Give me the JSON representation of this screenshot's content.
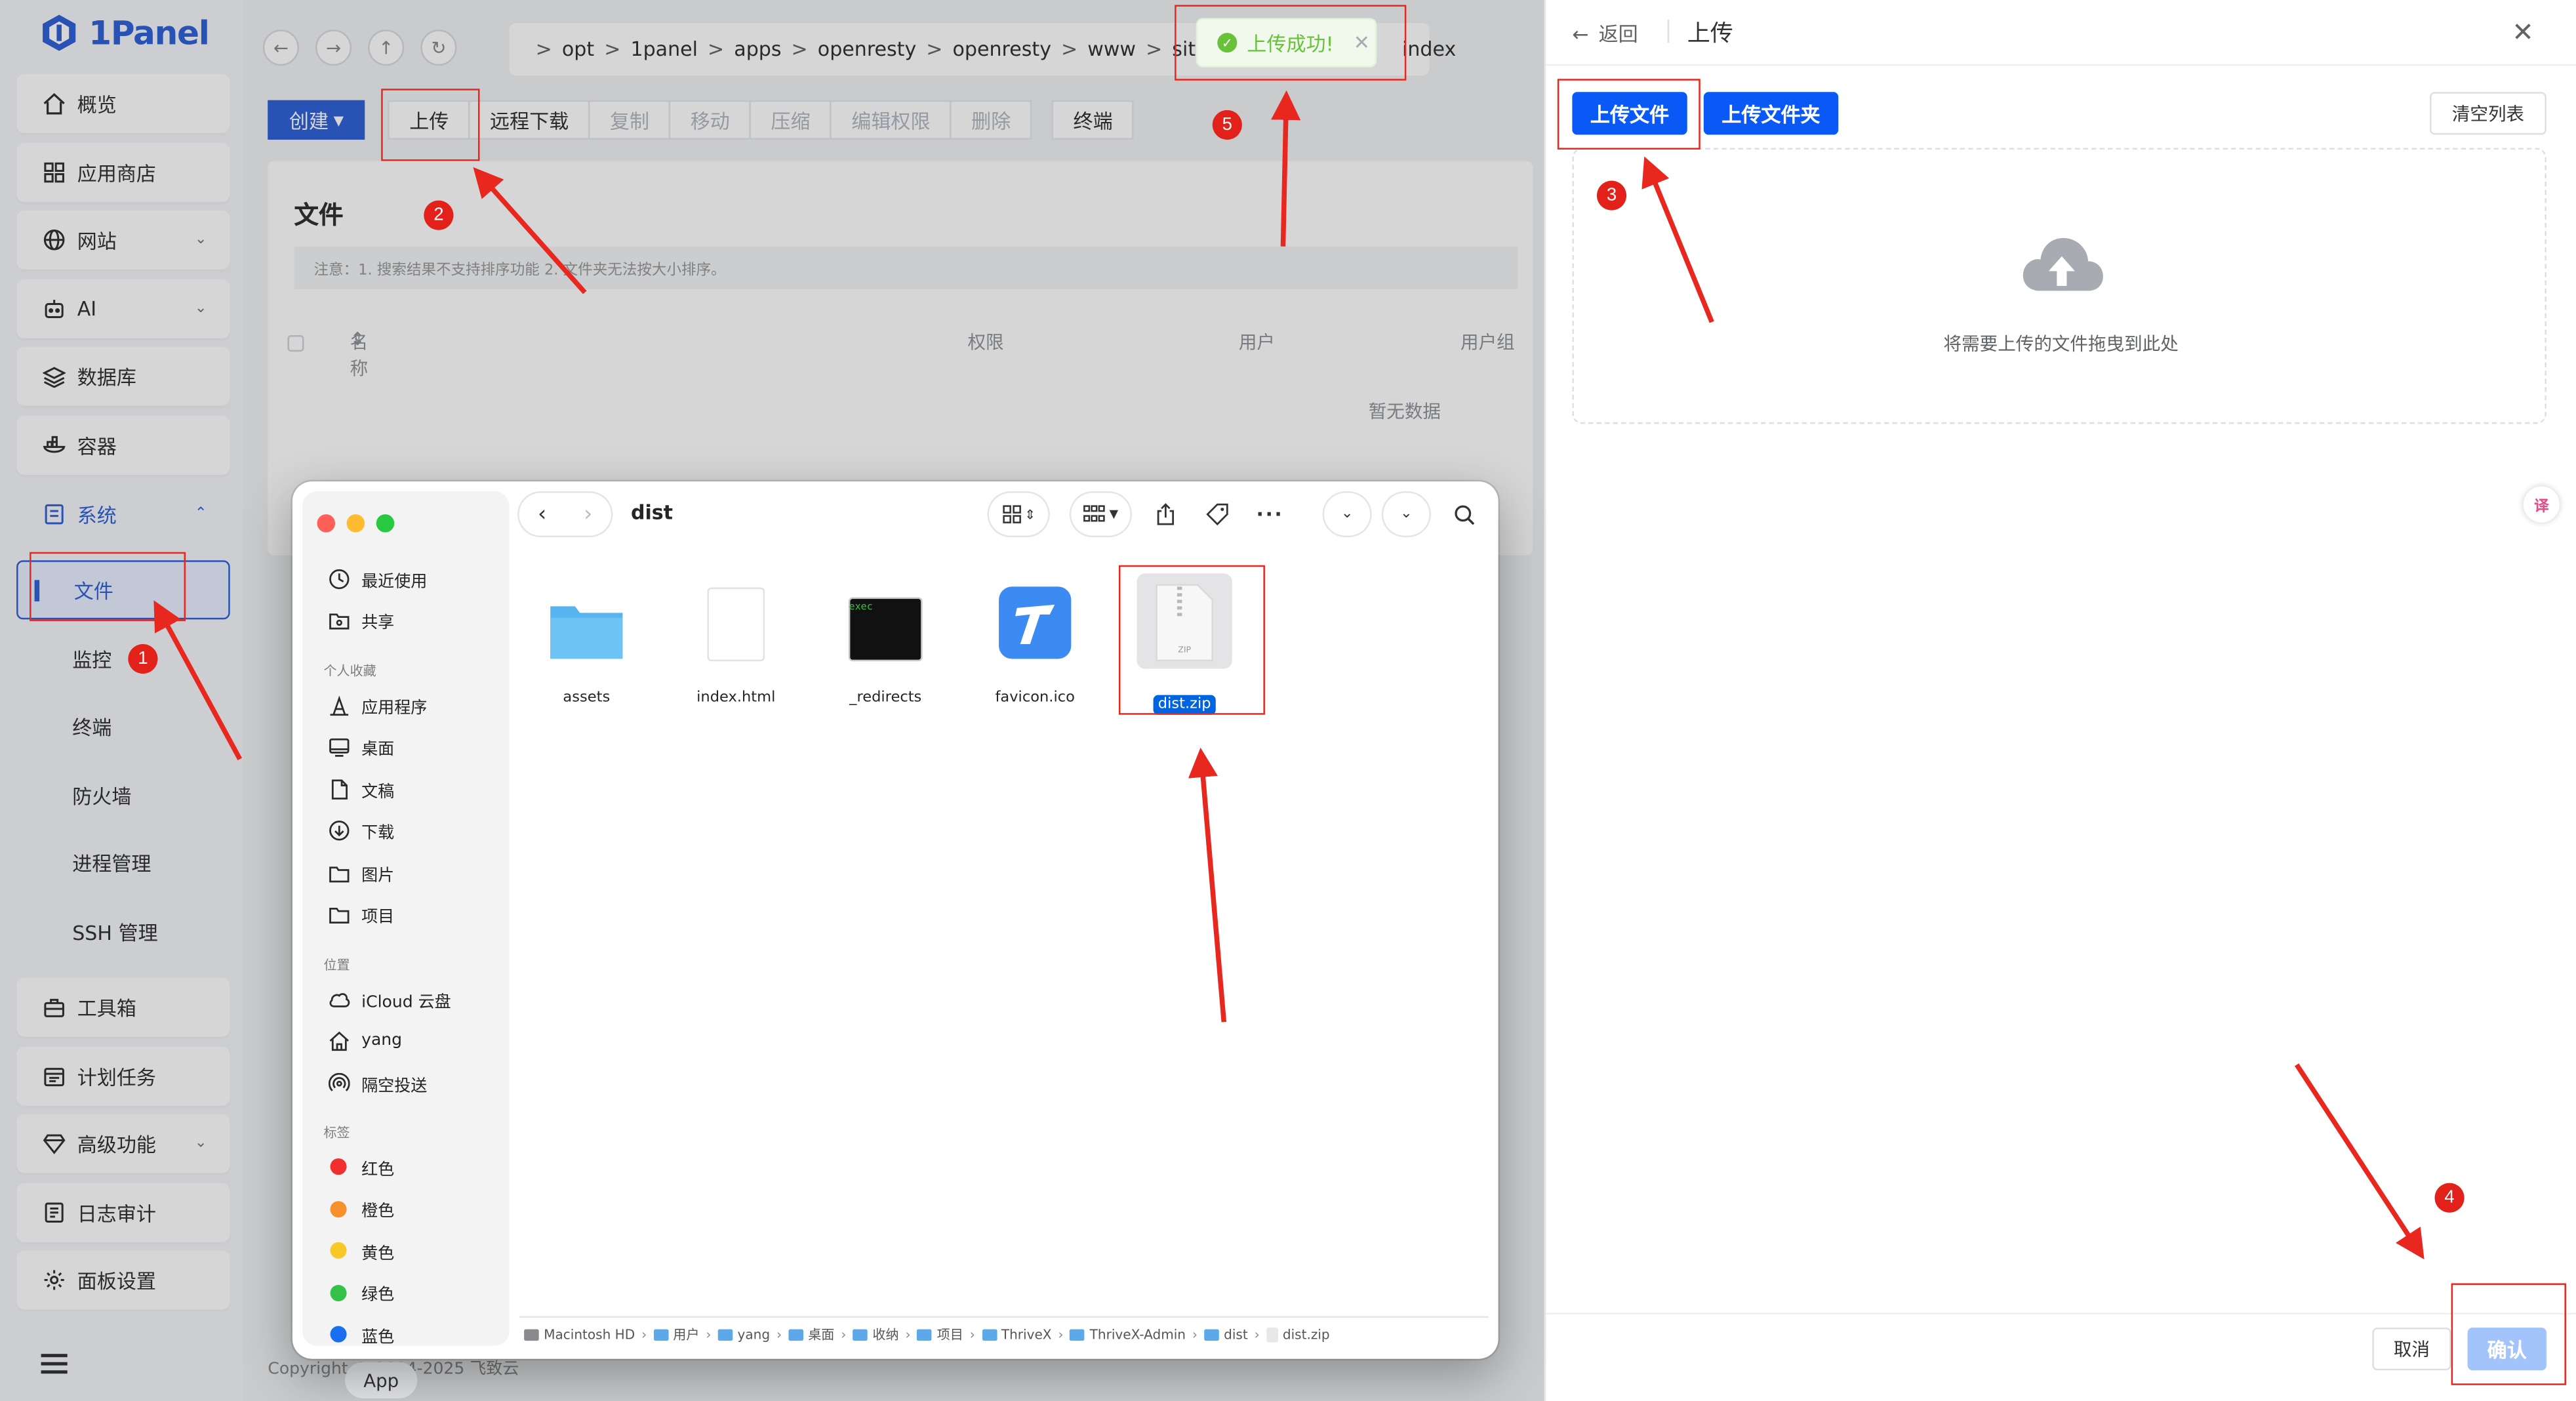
{
  "app": {
    "logo_text": "1Panel",
    "sidebar": {
      "items": [
        {
          "label": "概览",
          "icon": "home-icon"
        },
        {
          "label": "应用商店",
          "icon": "grid-icon"
        },
        {
          "label": "网站",
          "icon": "globe-icon"
        },
        {
          "label": "AI",
          "icon": "robot-icon"
        },
        {
          "label": "数据库",
          "icon": "database-icon"
        },
        {
          "label": "容器",
          "icon": "container-icon"
        },
        {
          "label": "系统",
          "icon": "system-icon"
        }
      ],
      "system_sub": [
        "文件",
        "监控",
        "终端",
        "防火墙",
        "进程管理",
        "SSH 管理"
      ],
      "more_items": [
        {
          "label": "工具箱",
          "icon": "toolbox-icon"
        },
        {
          "label": "计划任务",
          "icon": "calendar-icon"
        },
        {
          "label": "高级功能",
          "icon": "diamond-icon"
        },
        {
          "label": "日志审计",
          "icon": "log-icon"
        },
        {
          "label": "面板设置",
          "icon": "gear-icon"
        }
      ]
    },
    "path": [
      "opt",
      "1panel",
      "apps",
      "openresty",
      "openresty",
      "www",
      "sites"
    ],
    "path_tail": "index",
    "toolbar": {
      "create": "创建",
      "buttons": [
        "上传",
        "远程下载",
        "复制",
        "移动",
        "压缩",
        "编辑权限",
        "删除"
      ],
      "terminal": "终端"
    },
    "files": {
      "title": "文件",
      "note": "注意：1. 搜索结果不支持排序功能 2. 文件夹无法按大小排序。",
      "columns": {
        "name": "名称",
        "perm": "权限",
        "user": "用户",
        "group": "用户组"
      },
      "empty": "暂无数据"
    },
    "copyright": "Copyright © 2014-2025 飞致云",
    "app_pill": "App"
  },
  "toast": {
    "text": "上传成功!"
  },
  "drawer": {
    "back": "返回",
    "title": "上传",
    "upload_file": "上传文件",
    "upload_folder": "上传文件夹",
    "clear_list": "清空列表",
    "drop_hint": "将需要上传的文件拖曳到此处",
    "cancel": "取消",
    "confirm": "确认"
  },
  "finder": {
    "title": "dist",
    "sidebar": {
      "top": [
        {
          "label": "最近使用",
          "icon": "clock-icon"
        },
        {
          "label": "共享",
          "icon": "shared-folder-icon"
        }
      ],
      "favorites_header": "个人收藏",
      "favorites": [
        {
          "label": "应用程序",
          "icon": "apps-icon"
        },
        {
          "label": "桌面",
          "icon": "desktop-icon"
        },
        {
          "label": "文稿",
          "icon": "document-icon"
        },
        {
          "label": "下载",
          "icon": "download-icon"
        },
        {
          "label": "图片",
          "icon": "folder-icon"
        },
        {
          "label": "项目",
          "icon": "folder-icon"
        }
      ],
      "locations_header": "位置",
      "locations": [
        {
          "label": "iCloud 云盘",
          "icon": "cloud-icon"
        },
        {
          "label": "yang",
          "icon": "house-icon"
        },
        {
          "label": "隔空投送",
          "icon": "airdrop-icon"
        }
      ],
      "tags_header": "标签",
      "tags": [
        {
          "label": "红色",
          "color": "#f0302e"
        },
        {
          "label": "橙色",
          "color": "#f5902a"
        },
        {
          "label": "黄色",
          "color": "#f7c927"
        },
        {
          "label": "绿色",
          "color": "#34c14a"
        },
        {
          "label": "蓝色",
          "color": "#1a6ff0"
        }
      ]
    },
    "files": [
      {
        "name": "assets",
        "kind": "folder"
      },
      {
        "name": "index.html",
        "kind": "blank"
      },
      {
        "name": "_redirects",
        "kind": "exec"
      },
      {
        "name": "favicon.ico",
        "kind": "favicon"
      },
      {
        "name": "dist.zip",
        "kind": "zip",
        "selected": true
      }
    ],
    "exec_label": "exec",
    "zip_label": "ZIP",
    "path": [
      "Macintosh HD",
      "用户",
      "yang",
      "桌面",
      "收纳",
      "项目",
      "ThriveX",
      "ThriveX-Admin",
      "dist",
      "dist.zip"
    ]
  },
  "annotations": [
    "1",
    "2",
    "3",
    "4",
    "5"
  ],
  "colors": {
    "accent": "#3262d8",
    "upload_blue": "#0a59f7",
    "annotation_red": "#e8271f",
    "success": "#67c23a"
  }
}
